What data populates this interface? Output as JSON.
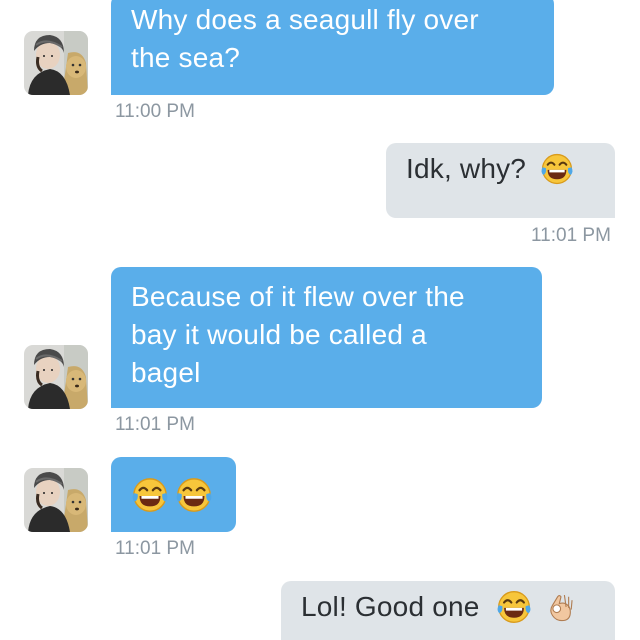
{
  "messages": [
    {
      "direction": "incoming",
      "text": "Why does a seagull fly over the sea?",
      "lines": [
        "Why does a seagull fly over",
        "the sea?"
      ],
      "time": "11:00 PM"
    },
    {
      "direction": "outgoing",
      "text": "Idk, why?",
      "emoji": [
        "face-with-tears-of-joy"
      ],
      "time": "11:01 PM"
    },
    {
      "direction": "incoming",
      "text": "Because of it flew over the bay it would be called a bagel",
      "lines": [
        "Because of it flew over the",
        "bay it would be called a",
        "bagel"
      ],
      "time": "11:01 PM"
    },
    {
      "direction": "incoming",
      "text": "",
      "emoji": [
        "face-with-tears-of-joy",
        "face-with-tears-of-joy"
      ],
      "time": "11:01 PM"
    },
    {
      "direction": "outgoing",
      "text": "Lol! Good one",
      "emoji": [
        "face-with-tears-of-joy",
        "ok-hand"
      ]
    }
  ],
  "colors": {
    "incoming_bubble": "#5aaeea",
    "outgoing_bubble": "#dfe4e8",
    "timestamp": "#8c97a1"
  }
}
